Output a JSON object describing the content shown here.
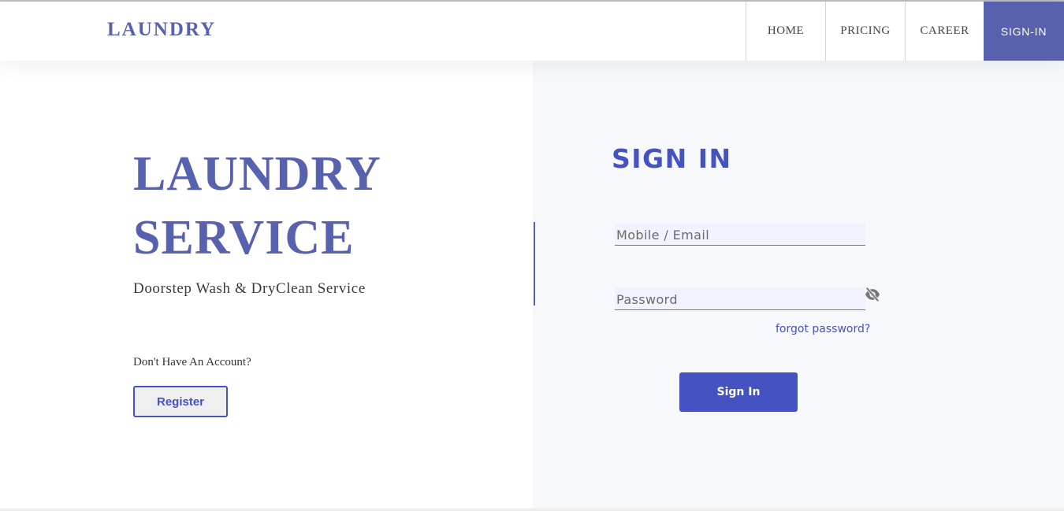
{
  "navbar": {
    "brand": "LAUNDRY",
    "items": [
      "HOME",
      "PRICING",
      "CAREER",
      "SIGN-IN"
    ]
  },
  "hero": {
    "title_line1": "LAUNDRY",
    "title_line2": "SERVICE",
    "subtitle": "Doorstep Wash & DryClean Service",
    "account_prompt": "Don't Have An Account?",
    "register_label": "Register"
  },
  "signin": {
    "heading": "SIGN IN",
    "email_placeholder": "Mobile / Email",
    "password_placeholder": "Password",
    "forgot_label": "forgot password?",
    "submit_label": "Sign In",
    "toggle_icon": "eye-slash-icon"
  },
  "colors": {
    "brand": "#5861ae",
    "accent": "#4552c1",
    "panel_bg": "#f7f8fc",
    "input_bg": "#f1f2fd"
  }
}
